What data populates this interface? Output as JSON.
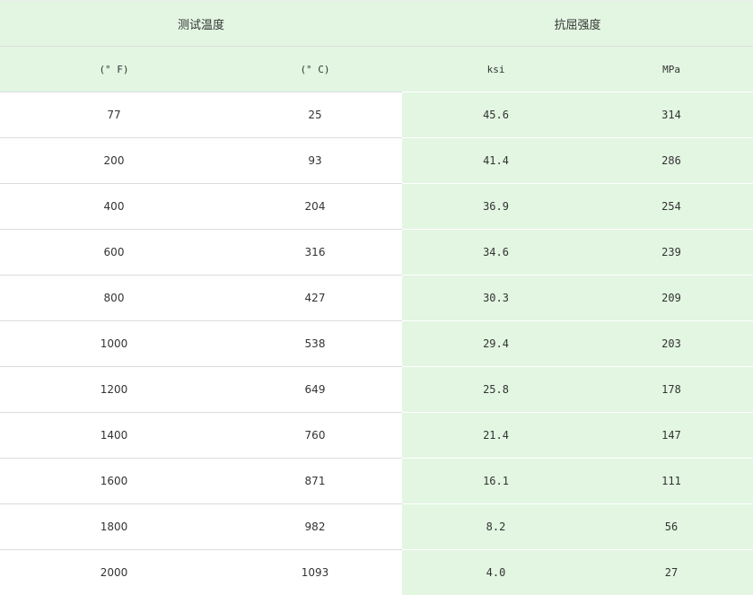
{
  "header": {
    "group_temperature": "测试温度",
    "group_strength": "抗屈强度",
    "unit_f": "(° F)",
    "unit_c": "(° C)",
    "unit_ksi": "ksi",
    "unit_mpa": "MPa"
  },
  "rows": [
    {
      "f": "77",
      "c": "25",
      "ksi": "45.6",
      "mpa": "314"
    },
    {
      "f": "200",
      "c": "93",
      "ksi": "41.4",
      "mpa": "286"
    },
    {
      "f": "400",
      "c": "204",
      "ksi": "36.9",
      "mpa": "254"
    },
    {
      "f": "600",
      "c": "316",
      "ksi": "34.6",
      "mpa": "239"
    },
    {
      "f": "800",
      "c": "427",
      "ksi": "30.3",
      "mpa": "209"
    },
    {
      "f": "1000",
      "c": "538",
      "ksi": "29.4",
      "mpa": "203"
    },
    {
      "f": "1200",
      "c": "649",
      "ksi": "25.8",
      "mpa": "178"
    },
    {
      "f": "1400",
      "c": "760",
      "ksi": "21.4",
      "mpa": "147"
    },
    {
      "f": "1600",
      "c": "871",
      "ksi": "16.1",
      "mpa": "111"
    },
    {
      "f": "1800",
      "c": "982",
      "ksi": "8.2",
      "mpa": "56"
    },
    {
      "f": "2000",
      "c": "1093",
      "ksi": "4.0",
      "mpa": "27"
    }
  ],
  "colors": {
    "header_bg": "#e2f6e2",
    "strength_bg": "#e2f6e2",
    "temp_bg": "#ffffff",
    "text": "#333333",
    "row_border": "#dcdcdc"
  }
}
